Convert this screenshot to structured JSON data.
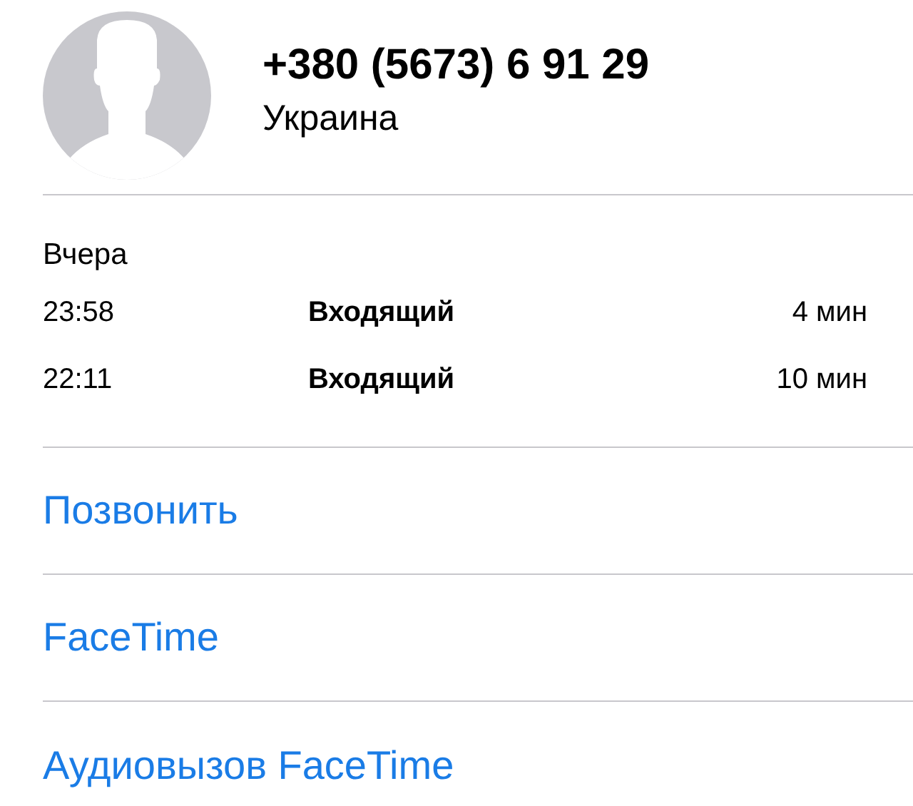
{
  "contact": {
    "phone": "+380 (5673) 6 91 29",
    "location": "Украина"
  },
  "calls": {
    "day": "Вчера",
    "rows": [
      {
        "time": "23:58",
        "type": "Входящий",
        "duration": "4 мин"
      },
      {
        "time": "22:11",
        "type": "Входящий",
        "duration": "10 мин"
      }
    ]
  },
  "actions": [
    "Позвонить",
    "FaceTime",
    "Аудиовызов FaceTime"
  ]
}
